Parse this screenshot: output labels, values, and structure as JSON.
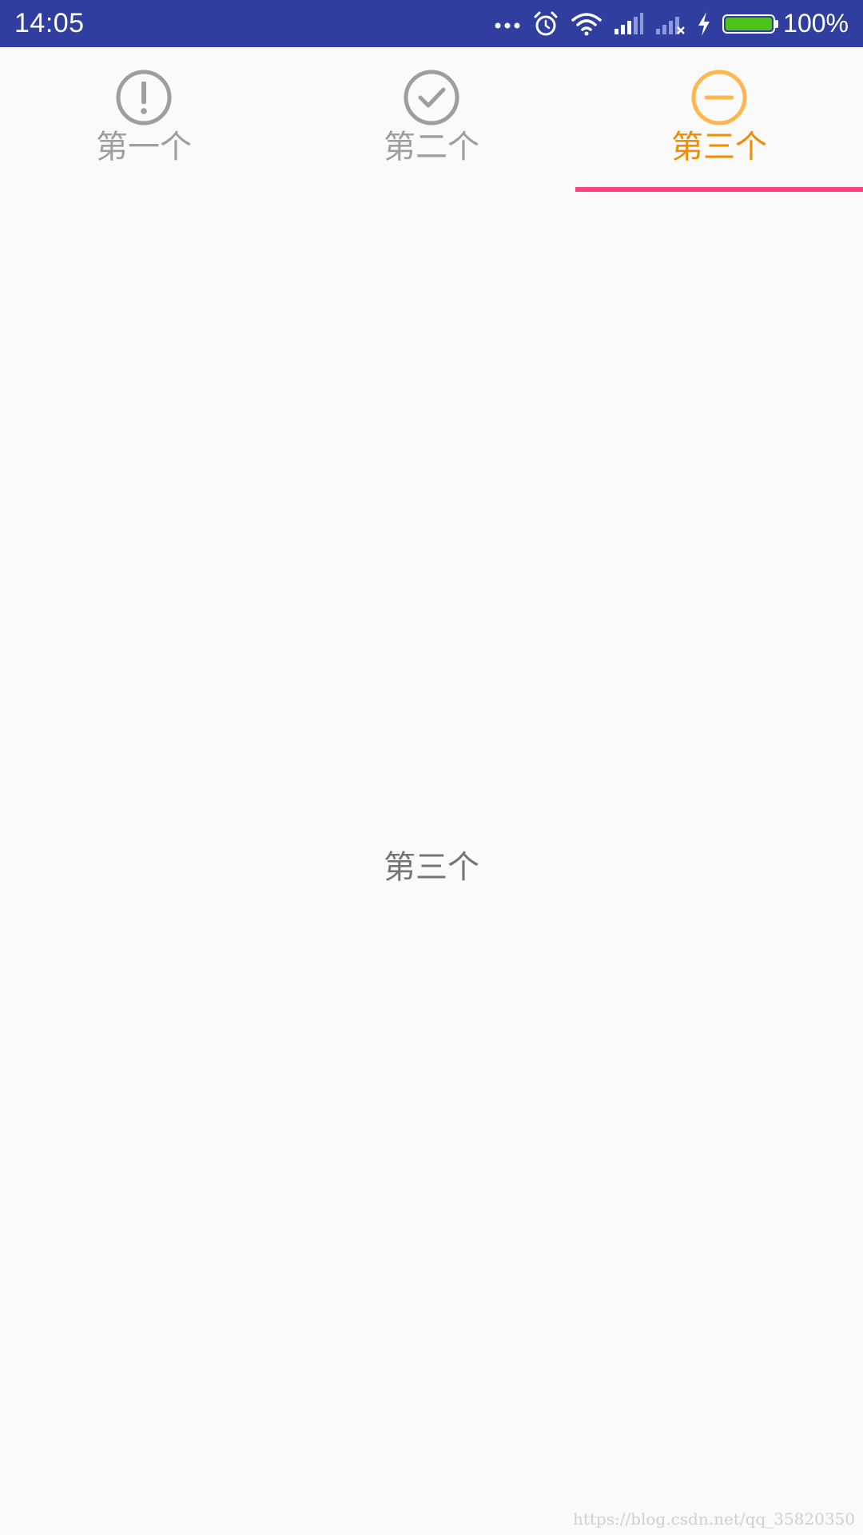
{
  "status_bar": {
    "time": "14:05",
    "battery_percent": "100%",
    "icons": [
      "more-dots-icon",
      "alarm-clock-icon",
      "wifi-icon",
      "signal-icon",
      "signal-no-sim-icon",
      "charging-bolt-icon",
      "battery-icon"
    ],
    "background": "#303f9f",
    "battery_level": 1.0
  },
  "tabs": [
    {
      "label": "第一个",
      "icon": "exclamation-circle-icon",
      "active": false
    },
    {
      "label": "第二个",
      "icon": "check-circle-icon",
      "active": false
    },
    {
      "label": "第三个",
      "icon": "minus-circle-icon",
      "active": true
    }
  ],
  "colors": {
    "active_tab_text": "#f08c00",
    "active_tab_icon": "#ffb74d",
    "inactive_tab": "#9e9e9e",
    "indicator": "#ff4081"
  },
  "content": {
    "text": "第三个"
  },
  "watermark": "https://blog.csdn.net/qq_35820350"
}
